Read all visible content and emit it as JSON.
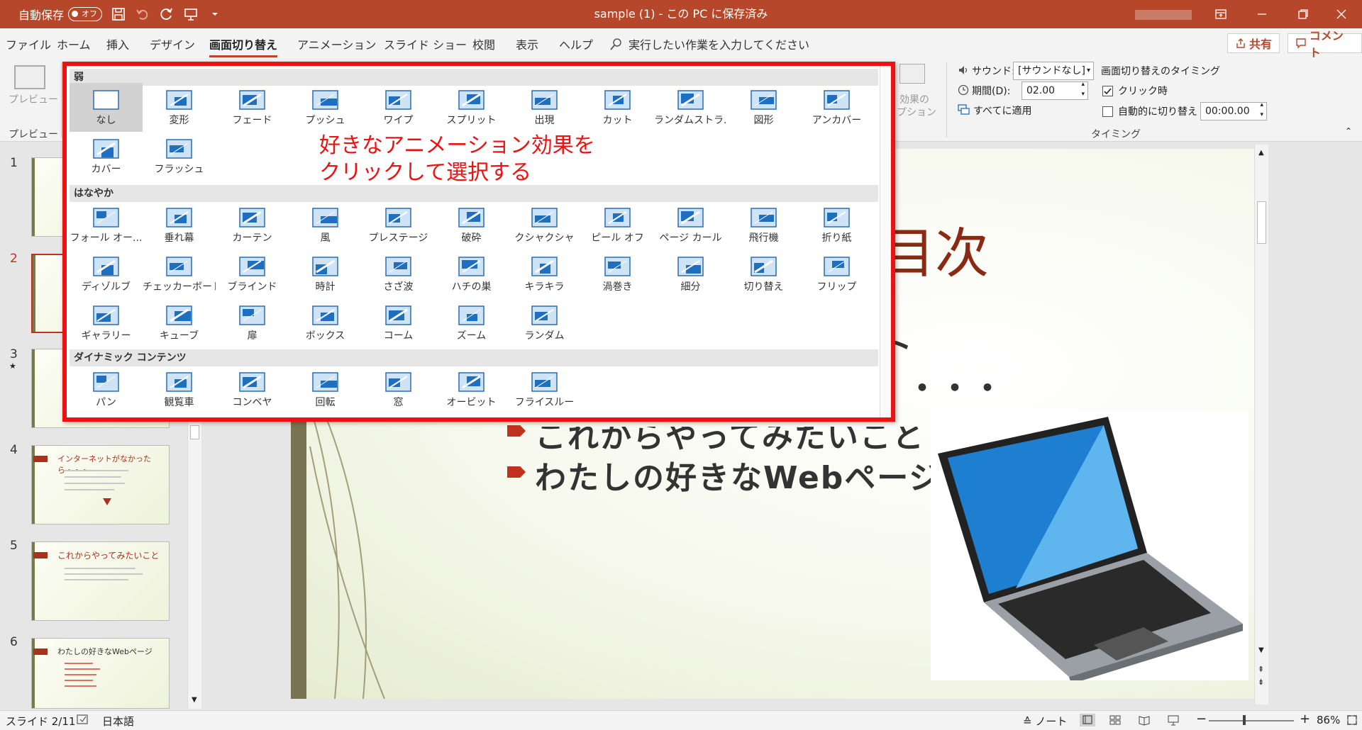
{
  "titlebar": {
    "autosave_label": "自動保存",
    "autosave_state": "オフ",
    "doc_title": "sample (1) - この PC に保存済み"
  },
  "tabs": [
    "ファイル",
    "ホーム",
    "挿入",
    "デザイン",
    "画面切り替え",
    "アニメーション",
    "スライド ショー",
    "校閲",
    "表示",
    "ヘルプ"
  ],
  "search_placeholder": "実行したい作業を入力してください",
  "share_label": "共有",
  "comment_label": "コメント",
  "ribbon": {
    "preview_btn": "プレビュー",
    "preview_group": "プレビュー",
    "effect_options_1": "効果の",
    "effect_options_2": "プション",
    "sound_label": "サウンド:",
    "sound_value": "[サウンドなし]",
    "duration_label": "期間(D):",
    "duration_value": "02.00",
    "apply_all": "すべてに適用",
    "timing_header": "画面切り替えのタイミング",
    "on_click": "クリック時",
    "after_label": "自動的に切り替え",
    "after_value": "00:00.00",
    "timing_group": "タイミング"
  },
  "gallery": {
    "sections": [
      {
        "title": "弱",
        "items": [
          "なし",
          "変形",
          "フェード",
          "プッシュ",
          "ワイプ",
          "スプリット",
          "出現",
          "カット",
          "ランダムストラ...",
          "図形",
          "アンカバー",
          "カバー",
          "フラッシュ"
        ]
      },
      {
        "title": "はなやか",
        "items": [
          "フォール オー...",
          "垂れ幕",
          "カーテン",
          "風",
          "プレステージ",
          "破砕",
          "クシャクシャ",
          "ピール オフ",
          "ページ カール",
          "飛行機",
          "折り紙",
          "ディゾルブ",
          "チェッカーボード",
          "ブラインド",
          "時計",
          "さざ波",
          "ハチの巣",
          "キラキラ",
          "渦巻き",
          "細分",
          "切り替え",
          "フリップ",
          "ギャラリー",
          "キューブ",
          "扉",
          "ボックス",
          "コーム",
          "ズーム",
          "ランダム"
        ]
      },
      {
        "title": "ダイナミック コンテンツ",
        "items": [
          "パン",
          "観覧車",
          "コンベヤ",
          "回転",
          "窓",
          "オービット",
          "フライスルー"
        ]
      }
    ]
  },
  "annotation": {
    "line1": "好きなアニメーション効果を",
    "line2": "クリックして選択する"
  },
  "thumbs": [
    {
      "num": "1",
      "title": ""
    },
    {
      "num": "2",
      "title": ""
    },
    {
      "num": "3",
      "title": ""
    },
    {
      "num": "4",
      "title": "インターネットがなかったら・・・"
    },
    {
      "num": "5",
      "title": "これからやってみたいこと"
    },
    {
      "num": "6",
      "title": "わたしの好きなWebページ"
    }
  ],
  "slide": {
    "title_part": "目次",
    "bullet1_tail": "ト",
    "bullet2_tail": "・・・・",
    "bullet3": "これからやってみたいこと",
    "bullet4": "わたしの好きなWebページ"
  },
  "status": {
    "slide_info": "スライド 2/11",
    "language": "日本語",
    "notes": "ノート",
    "zoom": "86%"
  }
}
